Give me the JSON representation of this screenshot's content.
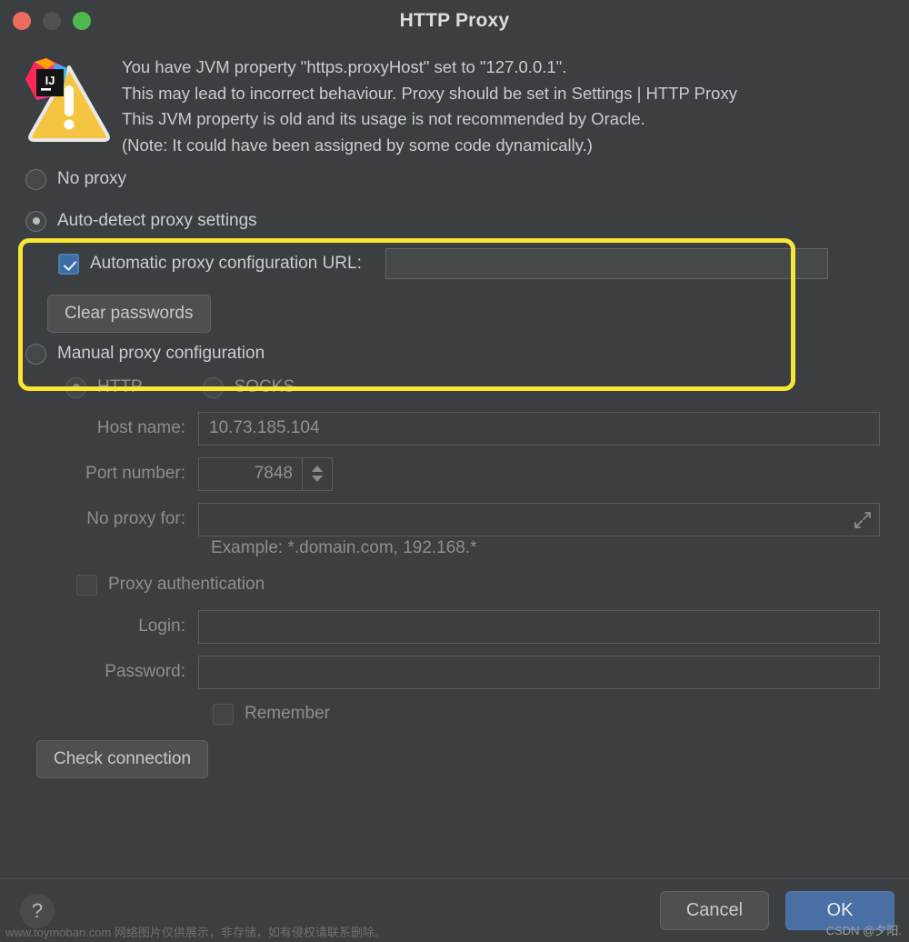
{
  "window": {
    "title": "HTTP Proxy",
    "traffic_lights": [
      "close-red",
      "minimize-gray",
      "zoom-green"
    ]
  },
  "warning": {
    "icon": "warning-triangle-icon",
    "badge": "intellij-idea-icon",
    "lines": [
      "You have JVM property \"https.proxyHost\" set to \"127.0.0.1\".",
      "This may lead to incorrect behaviour. Proxy should be set in Settings | HTTP Proxy",
      "This JVM property is old and its usage is not recommended by Oracle.",
      "(Note: It could have been assigned by some code dynamically.)"
    ]
  },
  "options": {
    "no_proxy": {
      "label": "No proxy",
      "selected": false
    },
    "auto_detect": {
      "label": "Auto-detect proxy settings",
      "selected": true
    },
    "manual": {
      "label": "Manual proxy configuration",
      "selected": false
    }
  },
  "auto_detect_group": {
    "pac_checkbox": {
      "label": "Automatic proxy configuration URL:",
      "checked": true
    },
    "pac_url_value": "",
    "clear_passwords_label": "Clear passwords",
    "highlight_color": "#f7e732"
  },
  "manual_group": {
    "protocol": {
      "http": {
        "label": "HTTP",
        "selected": true
      },
      "socks": {
        "label": "SOCKS",
        "selected": false
      }
    },
    "host_name": {
      "label": "Host name:",
      "value": "10.73.185.104"
    },
    "port_number": {
      "label": "Port number:",
      "value": "7848"
    },
    "no_proxy_for": {
      "label": "No proxy for:",
      "value": "",
      "expand_icon": "expand-icon"
    },
    "example_hint": "Example: *.domain.com, 192.168.*",
    "proxy_auth": {
      "label": "Proxy authentication",
      "checked": false
    },
    "login": {
      "label": "Login:",
      "value": ""
    },
    "password": {
      "label": "Password:",
      "value": ""
    },
    "remember": {
      "label": "Remember",
      "checked": false
    },
    "check_connection_label": "Check connection"
  },
  "footer": {
    "help_label": "?",
    "cancel_label": "Cancel",
    "ok_label": "OK",
    "ok_color": "#4a6fa5"
  },
  "watermarks": {
    "left": "www.toymoban.com 网络图片仅供展示，非存储，如有侵权请联系删除。",
    "right": "CSDN @夕阳."
  }
}
